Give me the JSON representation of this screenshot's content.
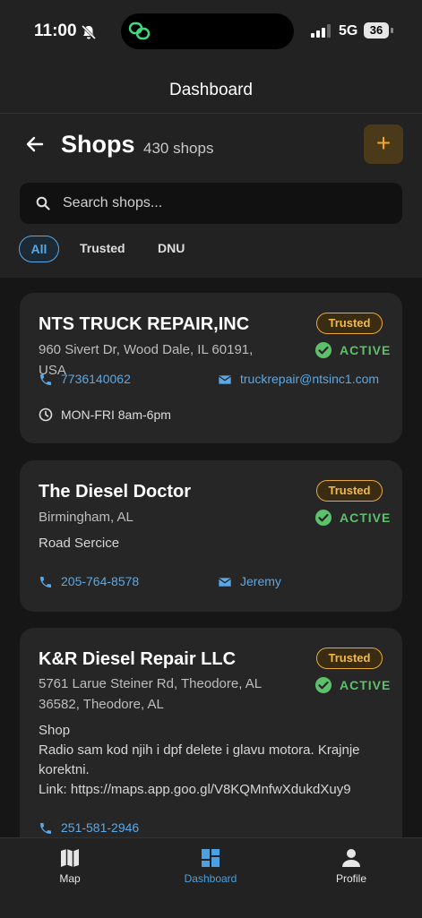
{
  "status_bar": {
    "time": "11:00",
    "network": "5G",
    "battery": "36"
  },
  "nav": {
    "title": "Dashboard"
  },
  "header": {
    "title": "Shops",
    "count": "430 shops",
    "add_label": "+"
  },
  "search": {
    "placeholder": "Search shops..."
  },
  "filters": [
    {
      "label": "All"
    },
    {
      "label": "Trusted"
    },
    {
      "label": "DNU"
    }
  ],
  "shops": [
    {
      "name": "NTS TRUCK REPAIR,INC",
      "address": "960 Sivert Dr, Wood Dale, IL 60191, USA",
      "badge": "Trusted",
      "status": "ACTIVE",
      "phone": "7736140062",
      "email": "truckrepair@ntsinc1.com",
      "hours": "MON-FRI 8am-6pm"
    },
    {
      "name": "The Diesel Doctor",
      "address": "Birmingham, AL",
      "badge": "Trusted",
      "status": "ACTIVE",
      "note": "Road Sercice",
      "phone": "205-764-8578",
      "email": "Jeremy"
    },
    {
      "name": "K&R Diesel Repair LLC",
      "address": "5761 Larue Steiner Rd, Theodore, AL 36582, Theodore, AL",
      "badge": "Trusted",
      "status": "ACTIVE",
      "note": "Shop\nRadio sam kod njih i dpf delete i glavu motora. Krajnje korektni.\nLink: https://maps.app.goo.gl/V8KQMnfwXdukdXuy9",
      "phone": "251-581-2946"
    }
  ],
  "tabs": [
    {
      "label": "Map"
    },
    {
      "label": "Dashboard"
    },
    {
      "label": "Profile"
    }
  ],
  "colors": {
    "accent": "#5aa8e6",
    "trusted": "#f0b94a",
    "active": "#5cc16a",
    "add": "#f5a623"
  }
}
